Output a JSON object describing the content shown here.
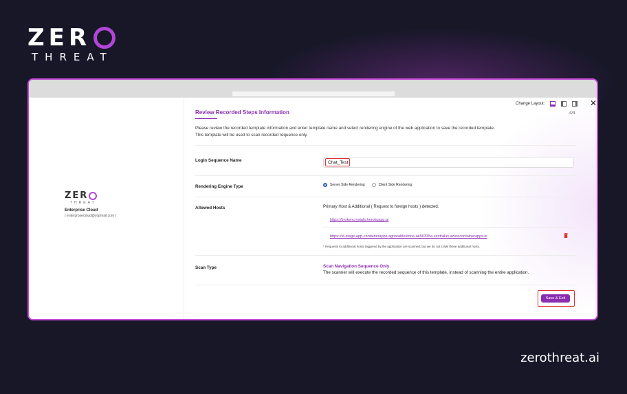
{
  "brand": {
    "word": "ZER",
    "sub": "THREAT",
    "site": "zerothreat.ai"
  },
  "sidebar": {
    "logo_word": "ZER",
    "logo_sub": "THREAT",
    "org_name": "Enterprise Cloud",
    "email": "( enterprosecloud@yopmail.com )"
  },
  "toolbar": {
    "change_layout_label": "Change Layout:",
    "step_counter": "4/4"
  },
  "section": {
    "title": "Review Recorded Steps Information",
    "description_line1": "Please review the recorded template information and enter template name and select rendering engine of the web application to save the recorded template.",
    "description_line2": "This template will be used to scan recorded requence only."
  },
  "login_sequence": {
    "label": "Login Sequence Name",
    "value": "Chat_Test"
  },
  "rendering": {
    "label": "Rendering Engine Type",
    "options": [
      {
        "label": "Server Side Rendering",
        "selected": true
      },
      {
        "label": "Client Side Rendering",
        "selected": false
      }
    ]
  },
  "hosts": {
    "label": "Allowed Hosts",
    "title": "Primary Host & Additional ( Request to foreign hosts ) detected.",
    "items": [
      "https://brokencrystals.herokuapp.ai",
      "https://vt-stage-app-containerapps.agreeablestone-ae56335a.centralus.azurecontainerapps.io"
    ],
    "note": "* Requests to additional hosts triggered by the application are scanned, but we do not crawl these additional hosts."
  },
  "scan_type": {
    "label": "Scan Type",
    "title": "Scan Navigation Sequence Only",
    "description": "The scanner will execute the recorded sequence of this template, instead of scanning the entire application."
  },
  "actions": {
    "save_exit": "Save & Exit"
  },
  "colors": {
    "accent": "#8a2db0",
    "frame_border": "#c34ad6",
    "background": "#171728",
    "highlight": "#dd3333"
  }
}
